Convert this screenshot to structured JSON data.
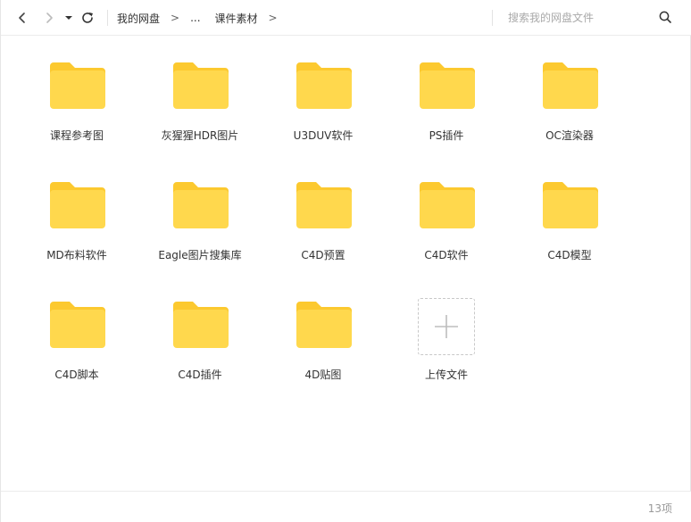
{
  "toolbar": {
    "icons": {
      "back": "chevron-left-icon",
      "forward": "chevron-right-icon",
      "dropdown": "caret-down-icon",
      "refresh": "refresh-icon",
      "search": "search-icon"
    },
    "breadcrumb": [
      {
        "label": "我的网盘"
      },
      {
        "label": "..."
      },
      {
        "label": "课件素材"
      }
    ],
    "breadcrumb_separator": ">",
    "search_placeholder": "搜索我的网盘文件"
  },
  "items": [
    {
      "name": "课程参考图",
      "type": "folder"
    },
    {
      "name": "灰猩猩HDR图片",
      "type": "folder"
    },
    {
      "name": "U3DUV软件",
      "type": "folder"
    },
    {
      "name": "PS插件",
      "type": "folder"
    },
    {
      "name": "OC渲染器",
      "type": "folder"
    },
    {
      "name": "MD布料软件",
      "type": "folder"
    },
    {
      "name": "Eagle图片搜集库",
      "type": "folder"
    },
    {
      "name": "C4D预置",
      "type": "folder"
    },
    {
      "name": "C4D软件",
      "type": "folder"
    },
    {
      "name": "C4D模型",
      "type": "folder"
    },
    {
      "name": "C4D脚本",
      "type": "folder"
    },
    {
      "name": "C4D插件",
      "type": "folder"
    },
    {
      "name": "4D贴图",
      "type": "folder"
    }
  ],
  "upload": {
    "label": "上传文件",
    "icon": "plus-icon"
  },
  "footer": {
    "count_text": "13项"
  },
  "colors": {
    "folder_back": "#fcc92f",
    "folder_front": "#ffd84d",
    "accent_text": "#333333",
    "muted_text": "#999999"
  }
}
